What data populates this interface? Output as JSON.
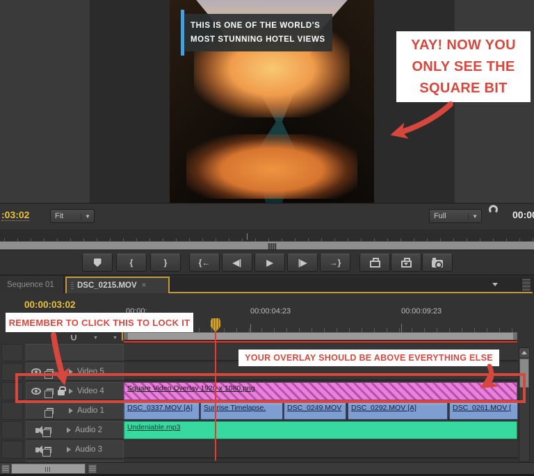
{
  "monitor": {
    "caption_line1": "THIS IS ONE OF THE WORLD'S",
    "caption_line2": "MOST STUNNING HOTEL VIEWS",
    "yay_line1": "YAY! NOW YOU",
    "yay_line2": "ONLY SEE THE",
    "yay_line3": "SQUARE BIT",
    "timecode_left": ":03:02",
    "zoom_value": "Fit",
    "resolution_value": "Full",
    "timecode_right": "00:00"
  },
  "transport": {
    "mark_in": "{",
    "mark_out": "}",
    "go_to_in": "{←",
    "step_back": "◀|",
    "play": "▶",
    "step_forward": "|▶",
    "go_to_out": "→}"
  },
  "tabs": {
    "sequence_tab": "Sequence 01",
    "clip_tab": "DSC_0215.MOV",
    "close": "×"
  },
  "timeline": {
    "playhead_timecode": "00:00:03:02",
    "ruler_label_0": "00:00:",
    "ruler_label_1": "00:00:04:23",
    "ruler_label_2": "00:00:09:23",
    "lock_note": "REMEMBER TO CLICK THIS TO LOCK IT",
    "overlay_note": "YOUR OVERLAY SHOULD BE ABOVE EVERYTHING ELSE",
    "track_video5": "Video 5",
    "track_video4": "Video 4",
    "track_audio1": "Audio 1",
    "track_audio2": "Audio 2",
    "track_audio3": "Audio 3",
    "clip_overlay": "Square Video Overlay 1920 x 1080.png",
    "clip_a1_0": "DSC_0337.MOV [A]",
    "clip_a1_1": "Sunrise Timelapse.",
    "clip_a1_2": "DSC_0249.MOV",
    "clip_a1_3": "DSC_0292.MOV [A]",
    "clip_a1_4": "DSC_0261.MOV [",
    "clip_a2_0": "Undeniable.mp3"
  },
  "icons": {
    "chevron_down": "▼"
  },
  "colors": {
    "annotation_red": "#d8473e",
    "panel_accent": "#c29a36",
    "timecode_yellow": "#e8c23a",
    "clip_magenta": "#e781d9",
    "clip_blue": "#7e9ed2",
    "clip_green": "#38d9a0"
  }
}
